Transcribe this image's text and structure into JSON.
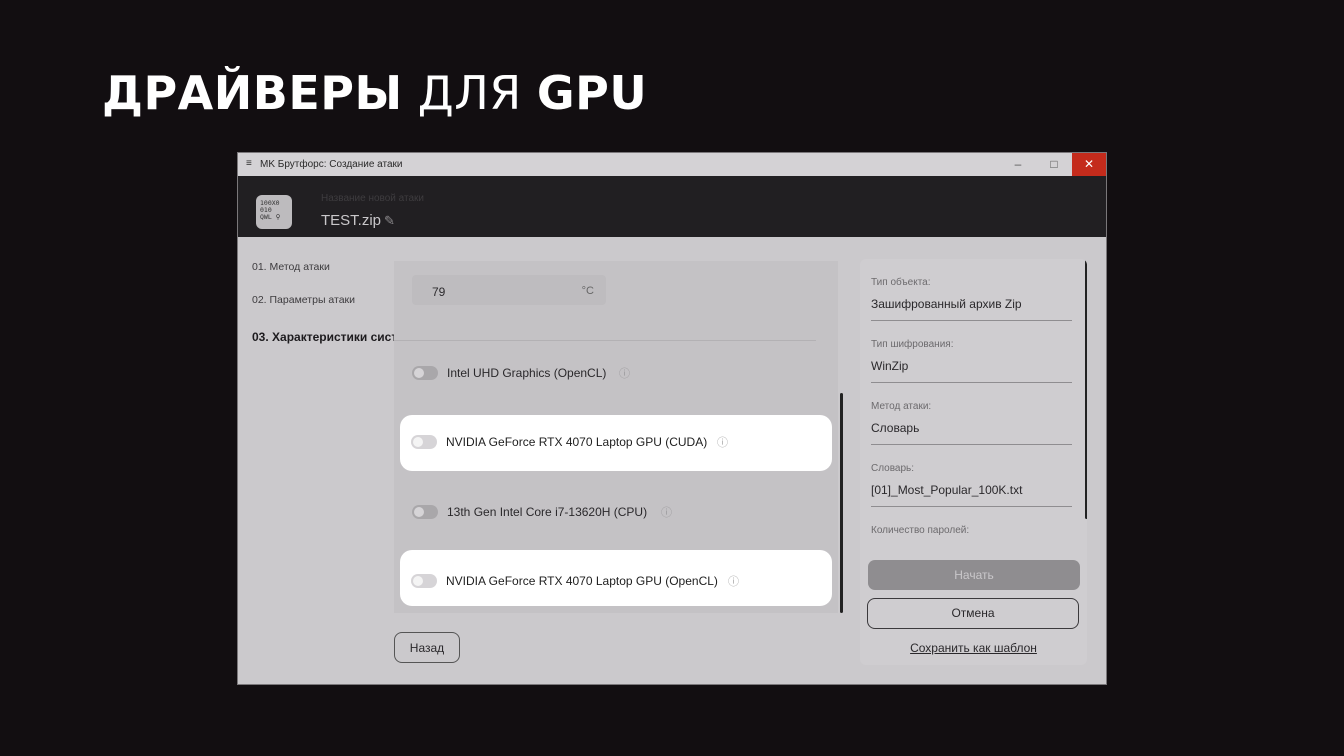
{
  "slide": {
    "title_bold_1": "ДРАЙВЕРЫ",
    "title_light": "ДЛЯ",
    "title_bold_2": "GPU"
  },
  "window": {
    "title": "MK Брутфорс: Создание атаки",
    "controls": {
      "minimize": "–",
      "maximize": "□",
      "close": "✕"
    }
  },
  "header": {
    "logo_text": "100X0\n010 \nQWL",
    "attack_name_label": "Название новой атаки",
    "attack_name": "TEST.zip"
  },
  "steps": [
    {
      "label": "01. Метод атаки"
    },
    {
      "label": "02. Параметры атаки"
    },
    {
      "label": "03. Характеристики системы",
      "active": true
    }
  ],
  "settings": {
    "temperature": {
      "value": "79",
      "unit": "°C"
    },
    "devices": [
      {
        "label": "Intel UHD Graphics (OpenCL)",
        "enabled": false
      },
      {
        "label": "NVIDIA GeForce RTX 4070 Laptop GPU (CUDA)",
        "enabled": false,
        "highlighted": true
      },
      {
        "label": "13th Gen Intel Core i7-13620H (CPU)",
        "enabled": false
      },
      {
        "label": "NVIDIA GeForce RTX 4070 Laptop GPU (OpenCL)",
        "enabled": false,
        "highlighted": true
      }
    ]
  },
  "buttons": {
    "back": "Назад",
    "start": "Начать",
    "cancel": "Отмена",
    "save_template": "Сохранить как шаблон"
  },
  "summary": {
    "fields": [
      {
        "label": "Тип объекта:",
        "value": "Зашифрованный архив Zip"
      },
      {
        "label": "Тип шифрования:",
        "value": "WinZip"
      },
      {
        "label": "Метод атаки:",
        "value": "Словарь"
      },
      {
        "label": "Словарь:",
        "value": "[01]_Most_Popular_100K.txt"
      },
      {
        "label": "Количество паролей:",
        "value": ""
      }
    ]
  },
  "icons": {
    "info": "ⓘ",
    "edit": "✎"
  }
}
